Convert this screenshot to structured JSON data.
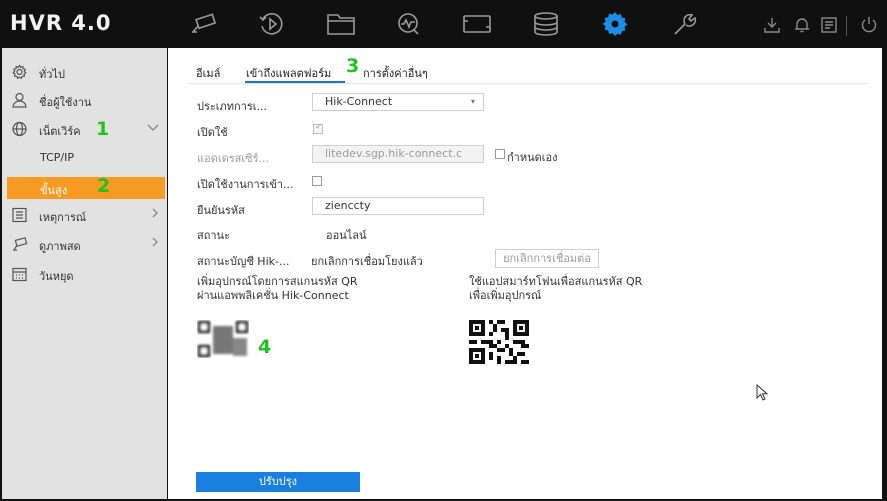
{
  "app": {
    "logo": "HVR 4.0"
  },
  "topnav": {
    "items": [
      {
        "name": "live-view-icon"
      },
      {
        "name": "playback-icon"
      },
      {
        "name": "file-management-icon"
      },
      {
        "name": "smart-analysis-icon"
      },
      {
        "name": "intelligent-icon"
      },
      {
        "name": "storage-icon"
      },
      {
        "name": "configuration-icon",
        "active": true
      },
      {
        "name": "maintenance-icon"
      }
    ],
    "utility": [
      "download-icon",
      "alarm-bell-icon",
      "notification-icon",
      "power-icon"
    ]
  },
  "sidebar": {
    "items": [
      {
        "label": "ทั่วไป",
        "icon": "gear-icon"
      },
      {
        "label": "ชื่อผู้ใช้งาน",
        "icon": "user-icon"
      },
      {
        "label": "เน็ตเวิร์ค",
        "icon": "globe-icon",
        "expanded": true,
        "children": [
          {
            "label": "TCP/IP"
          },
          {
            "label": "ขั้นสูง",
            "active": true
          }
        ]
      },
      {
        "label": "เหตุการณ์",
        "icon": "event-list-icon"
      },
      {
        "label": "ดูภาพสด",
        "icon": "camera-icon"
      },
      {
        "label": "วันหยุด",
        "icon": "calendar-icon"
      }
    ]
  },
  "annotations": {
    "a1": "1",
    "a2": "2",
    "a3": "3",
    "a4": "4"
  },
  "tabs": [
    {
      "label": "อีเมล์"
    },
    {
      "label": "เข้าถึงแพลตฟอร์ม",
      "active": true
    },
    {
      "label": "การตั้งค่าอื่นๆ"
    }
  ],
  "form": {
    "access_type_label": "ประเภทการเ...",
    "access_type_value": "Hik-Connect",
    "enable_label": "เปิดใช้",
    "server_label": "แอดเดรสเซิร์...",
    "server_value": "litedev.sgp.hik-connect.c",
    "custom_label": "กำหนดเอง",
    "stream_enc_label": "เปิดใช้งานการเข้า...",
    "verify_label": "ยืนยันรหัส",
    "verify_value": "zienccty",
    "status_label": "สถานะ",
    "status_value": "ออนไลน์",
    "bind_status_label": "สถานะบัญชี Hik-...",
    "bind_status_value": "ยกเลิกการเชื่อมโยงแล้ว",
    "unbind_button": "ยกเลิกการเชื่อมต่อ"
  },
  "qr": {
    "left_line1": "เพิ่มอุปกรณ์โดยการสแกนรหัส QR",
    "left_line2": "ผ่านแอพพลิเคชั่น Hik-Connect",
    "right_line1": "ใช้แอปสมาร์ทโฟนเพื่อสแกนรหัส QR",
    "right_line2": "เพื่อเพิ่มอุปกรณ์"
  },
  "actions": {
    "save": "ปรับปรุง"
  },
  "colors": {
    "accent": "#1a80e0",
    "active_menu": "#f79a24",
    "annotation": "#1fc21f",
    "topbar": "#101010",
    "active_icon": "#1b8fe8"
  }
}
